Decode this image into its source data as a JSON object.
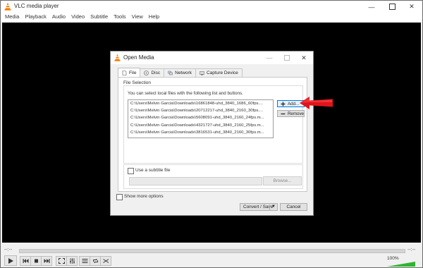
{
  "window": {
    "title": "VLC media player"
  },
  "menu": [
    "Media",
    "Playback",
    "Audio",
    "Video",
    "Subtitle",
    "Tools",
    "View",
    "Help"
  ],
  "player": {
    "time_elapsed": "--:--",
    "time_total": "--:--",
    "volume_label": "100%",
    "volume_level": 1.0
  },
  "dialog": {
    "title": "Open Media",
    "tabs": [
      "File",
      "Disc",
      "Network",
      "Capture Device"
    ],
    "active_tab": "File",
    "file_selection_title": "File Selection",
    "file_selection_desc": "You can select local files with the following list and buttons.",
    "files": [
      "C:\\Users\\Melvin Garcia\\Downloads\\16861848-uhd_3840_1686_60fps....",
      "C:\\Users\\Melvin Garcia\\Downloads\\20712217-uhd_3840_2160_30fps....",
      "C:\\Users\\Melvin Garcia\\Downloads\\5608091-uhd_3840_2160_24fps.m...",
      "C:\\Users\\Melvin Garcia\\Downloads\\4321727-uhd_3840_2160_25fps.m...",
      "C:\\Users\\Melvin Garcia\\Downloads\\3816531-uhd_3840_2160_30fps.m..."
    ],
    "add_label": "Add...",
    "remove_label": "Remove",
    "subtitle_checkbox_label": "Use a subtitle file",
    "browse_label": "Browse...",
    "show_more_label": "Show more options",
    "convert_label": "Convert / Save",
    "cancel_label": "Cancel"
  },
  "colors": {
    "accent_arrow": "#e0141c",
    "volume_green": "#2fb52f",
    "focus_blue": "#0078d7"
  }
}
